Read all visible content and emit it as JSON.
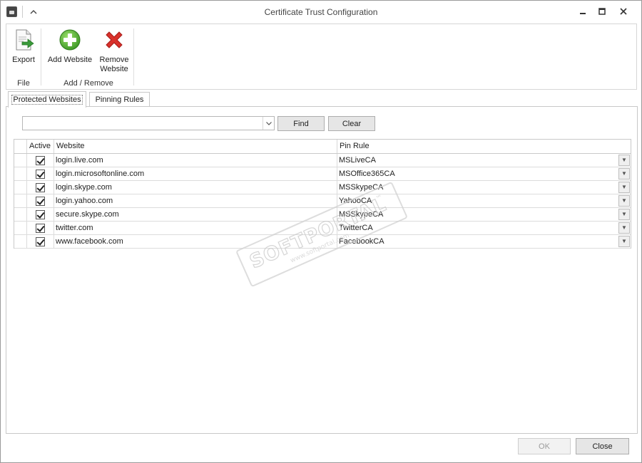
{
  "window": {
    "title": "Certificate Trust Configuration",
    "controls": {
      "minimize": "▁",
      "maximize": "☐",
      "close": "✕"
    },
    "collapse_glyph": "^"
  },
  "ribbon": {
    "export_label": "Export",
    "add_website_label": "Add Website",
    "remove_website_label_line1": "Remove",
    "remove_website_label_line2": "Website",
    "group_file": "File",
    "group_add_remove": "Add / Remove"
  },
  "tabs": [
    {
      "label": "Protected Websites",
      "active": true
    },
    {
      "label": "Pinning Rules",
      "active": false
    }
  ],
  "search": {
    "value": "",
    "find_label": "Find",
    "clear_label": "Clear"
  },
  "grid": {
    "columns": [
      "Active",
      "Website",
      "Pin Rule"
    ],
    "rows": [
      {
        "active": true,
        "website": "login.live.com",
        "pin_rule": "MSLiveCA"
      },
      {
        "active": true,
        "website": "login.microsoftonline.com",
        "pin_rule": "MSOffice365CA"
      },
      {
        "active": true,
        "website": "login.skype.com",
        "pin_rule": "MSSkypeCA"
      },
      {
        "active": true,
        "website": "login.yahoo.com",
        "pin_rule": "YahooCA"
      },
      {
        "active": true,
        "website": "secure.skype.com",
        "pin_rule": "MSSkypeCA"
      },
      {
        "active": true,
        "website": "twitter.com",
        "pin_rule": "TwitterCA"
      },
      {
        "active": true,
        "website": "www.facebook.com",
        "pin_rule": "FacebookCA"
      }
    ]
  },
  "watermark": {
    "text": "SOFTPORTAL",
    "subtext": "www.softportal.com",
    "mark": "™"
  },
  "footer": {
    "ok_label": "OK",
    "close_label": "Close"
  },
  "colors": {
    "add_icon": "#4caf2f",
    "remove_icon": "#d9312b",
    "export_icon": "#3a9a3a"
  }
}
